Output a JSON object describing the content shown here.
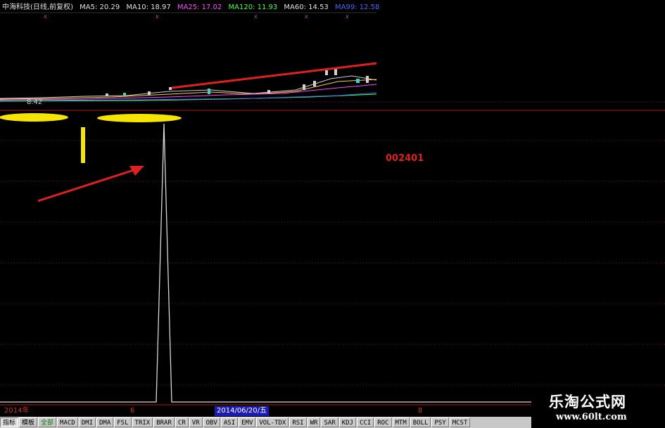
{
  "legend": {
    "title": "中海科技(日线,前复权)",
    "ma5": "MA5: 20.29",
    "ma10": "MA10: 18.97",
    "ma25": "MA25: 17.02",
    "ma120": "MA120: 11.93",
    "ma60": "MA60: 14.53",
    "ma99": "MA99: 12.58"
  },
  "price_low_label": "8.42",
  "stock_code": "002401",
  "date_axis": {
    "year": "2014年",
    "m6": "6",
    "current": "2014/06/20/五",
    "m8": "8"
  },
  "tabs": [
    "指标",
    "模板",
    "全部",
    "MACD",
    "DMI",
    "DMA",
    "FSL",
    "TRIX",
    "BRAR",
    "CR",
    "VR",
    "OBV",
    "ASI",
    "EMV",
    "VOL-TDX",
    "RSI",
    "WR",
    "SAR",
    "KDJ",
    "CCI",
    "ROC",
    "MTM",
    "BOLL",
    "PSY",
    "MCST"
  ],
  "watermark": {
    "name": "乐淘公式网",
    "url": "www.60lt.com"
  },
  "colors": {
    "background": "#000000",
    "grid_line": "#7a1010",
    "annotation_red": "#e02020",
    "highlight_yellow": "#f5e400",
    "indicator_line": "#d8d8d8",
    "tab_bar": "#c8c8c8"
  }
}
